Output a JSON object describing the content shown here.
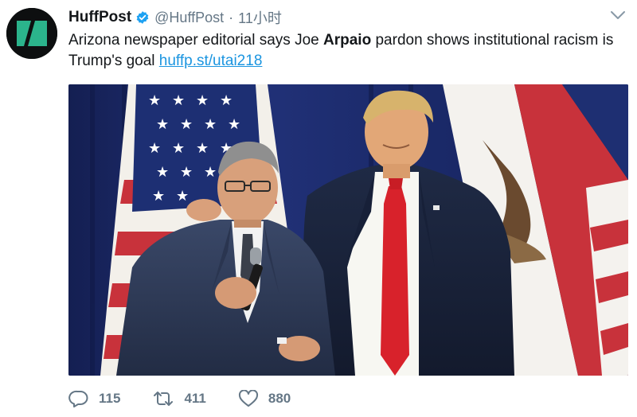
{
  "author": {
    "display_name": "HuffPost",
    "handle": "@HuffPost",
    "separator": "·",
    "time": "11小时",
    "avatar_icon": "huffpost-logo-icon"
  },
  "tweet": {
    "text_before": "Arizona newspaper editorial says Joe ",
    "text_bold": "Arpaio",
    "text_after": " pardon shows institutional racism is Trump's goal ",
    "link": "huffp.st/utai218"
  },
  "actions": {
    "reply_count": "115",
    "retweet_count": "411",
    "like_count": "880"
  },
  "colors": {
    "accent_link": "#1b95e0",
    "verified_badge": "#1da1f2",
    "muted": "#657786",
    "logo_green": "#2bb48c"
  }
}
